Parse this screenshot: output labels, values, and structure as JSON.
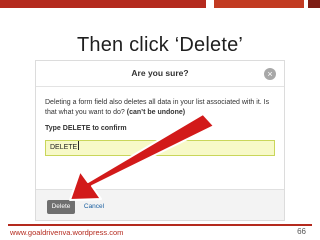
{
  "slide": {
    "title": "Then click ‘Delete’",
    "footer_url": "www.goaldrivenva.wordpress.com",
    "page_number": "66"
  },
  "dialog": {
    "title": "Are you sure?",
    "close_glyph": "×",
    "message_part1": "Deleting a form field also deletes all data in your list associated with it. Is that what you want to do?",
    "message_strong": "(can’t be undone)",
    "confirm_label": "Type DELETE to confirm",
    "input_value": "DELETE",
    "delete_button_label": "Delete",
    "cancel_label": "Cancel"
  },
  "colors": {
    "accent_red": "#b42a1e",
    "arrow_red": "#d21a1a",
    "input_highlight": "#f7f9c8"
  }
}
